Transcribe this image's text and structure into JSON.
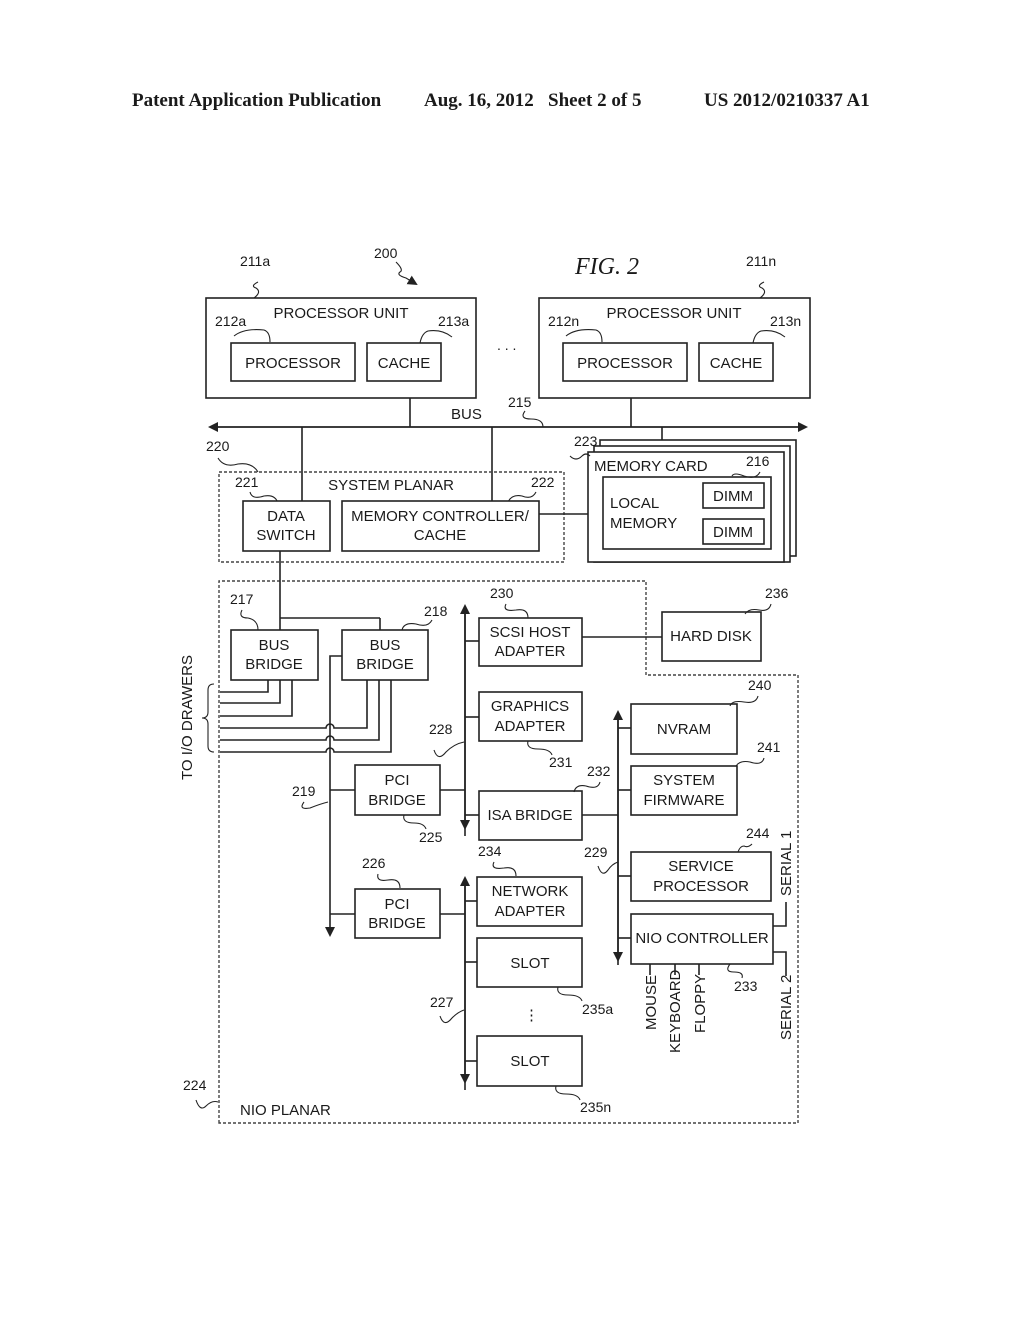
{
  "header": {
    "publication": "Patent Application Publication",
    "date_sheet": "Aug. 16, 2012   Sheet 2 of 5",
    "number": "US 2012/0210337 A1"
  },
  "figure": {
    "title": "FIG. 2",
    "ref_main": "200",
    "ellipsis": ". . .",
    "processor_units": [
      {
        "ref": "211a",
        "label": "PROCESSOR UNIT",
        "processor_ref": "212a",
        "processor": "PROCESSOR",
        "cache_ref": "213a",
        "cache": "CACHE"
      },
      {
        "ref": "211n",
        "label": "PROCESSOR UNIT",
        "processor_ref": "212n",
        "processor": "PROCESSOR",
        "cache_ref": "213n",
        "cache": "CACHE"
      }
    ],
    "bus": {
      "label": "BUS",
      "ref": "215"
    },
    "system_planar": {
      "ref": "220",
      "label": "SYSTEM PLANAR",
      "data_switch": {
        "ref": "221",
        "line1": "DATA",
        "line2": "SWITCH"
      },
      "mem_ctrl": {
        "ref": "222",
        "line1": "MEMORY CONTROLLER/",
        "line2": "CACHE"
      }
    },
    "memory_card": {
      "ref": "223",
      "label": "MEMORY CARD",
      "local_ref": "216",
      "local1": "LOCAL",
      "local2": "MEMORY",
      "dimm": "DIMM"
    },
    "io_drawers": "TO I/O DRAWERS",
    "bus_bridges": [
      {
        "ref": "217",
        "line1": "BUS",
        "line2": "BRIDGE"
      },
      {
        "ref": "218",
        "line1": "BUS",
        "line2": "BRIDGE"
      }
    ],
    "pci_bridges": [
      {
        "ref": "225",
        "line1": "PCI",
        "line2": "BRIDGE"
      },
      {
        "ref": "226",
        "line1": "PCI",
        "line2": "BRIDGE"
      }
    ],
    "refs": {
      "r219": "219",
      "r228": "228",
      "r227": "227",
      "r229": "229",
      "r224": "224"
    },
    "scsi": {
      "ref": "230",
      "line1": "SCSI HOST",
      "line2": "ADAPTER"
    },
    "hard_disk": {
      "ref": "236",
      "label": "HARD DISK"
    },
    "graphics": {
      "ref": "231",
      "line1": "GRAPHICS",
      "line2": "ADAPTER"
    },
    "isa": {
      "ref": "232",
      "label": "ISA BRIDGE"
    },
    "network": {
      "ref": "234",
      "line1": "NETWORK",
      "line2": "ADAPTER"
    },
    "slots": [
      {
        "ref": "235a",
        "label": "SLOT"
      },
      {
        "ref": "235n",
        "label": "SLOT"
      }
    ],
    "nvram": {
      "ref": "240",
      "label": "NVRAM"
    },
    "firmware": {
      "ref": "241",
      "line1": "SYSTEM",
      "line2": "FIRMWARE"
    },
    "service": {
      "ref": "244",
      "line1": "SERVICE",
      "line2": "PROCESSOR"
    },
    "nio": {
      "ref": "233",
      "label": "NIO CONTROLLER"
    },
    "nio_ports": [
      "MOUSE",
      "KEYBOARD",
      "FLOPPY"
    ],
    "serial": [
      "SERIAL 1",
      "SERIAL 2"
    ],
    "nio_planar": "NIO PLANAR"
  }
}
